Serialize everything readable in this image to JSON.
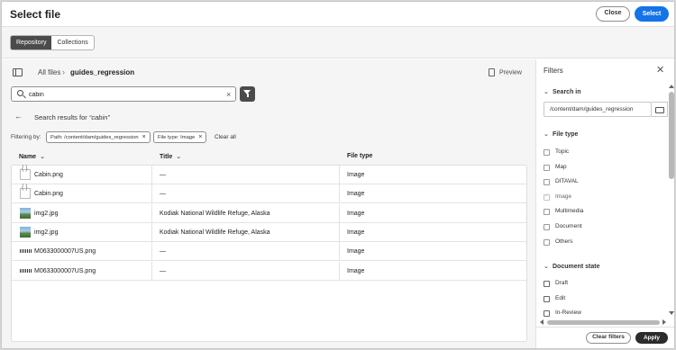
{
  "header": {
    "title": "Select file",
    "close_label": "Close",
    "select_label": "Select"
  },
  "tabs": [
    {
      "label": "Repository",
      "active": true
    },
    {
      "label": "Collections",
      "active": false
    }
  ],
  "breadcrumb": {
    "root": "All files",
    "current": "guides_regression"
  },
  "preview_label": "Preview",
  "search": {
    "value": "cabin",
    "placeholder": ""
  },
  "results": {
    "prefix": "Search results for",
    "query": "“cabin”"
  },
  "filtering": {
    "label": "Filtering by:",
    "chips": [
      "Path: /content/dam/guides_regression",
      "File type: Image"
    ],
    "clear_all": "Clear all"
  },
  "table": {
    "columns": [
      "Name",
      "Title",
      "File type"
    ],
    "rows": [
      {
        "thumb": "cabin",
        "name": "Cabin.png",
        "title": "—",
        "type": "Image"
      },
      {
        "thumb": "cabin",
        "name": "Cabin.png",
        "title": "—",
        "type": "Image"
      },
      {
        "thumb": "img2",
        "name": "img2.jpg",
        "title": "Kodiak National Wildlife Refuge, Alaska",
        "type": "Image"
      },
      {
        "thumb": "img2",
        "name": "img2.jpg",
        "title": "Kodiak National Wildlife Refuge, Alaska",
        "type": "Image"
      },
      {
        "thumb": "mcode",
        "name": "M0633000007US.png",
        "title": "—",
        "type": "Image"
      },
      {
        "thumb": "mcode",
        "name": "M0633000007US.png",
        "title": "—",
        "type": "Image"
      }
    ]
  },
  "filters": {
    "title": "Filters",
    "search_in": {
      "label": "Search in",
      "path": "/content/dam/guides_regression"
    },
    "file_type": {
      "label": "File type",
      "options": [
        {
          "label": "Topic",
          "checked": false,
          "disabled": false
        },
        {
          "label": "Map",
          "checked": false,
          "disabled": false
        },
        {
          "label": "DITAVAL",
          "checked": false,
          "disabled": false
        },
        {
          "label": "Image",
          "checked": true,
          "disabled": true
        },
        {
          "label": "Multimedia",
          "checked": false,
          "disabled": false
        },
        {
          "label": "Document",
          "checked": false,
          "disabled": false
        },
        {
          "label": "Others",
          "checked": false,
          "disabled": false
        }
      ]
    },
    "document_state": {
      "label": "Document state",
      "options": [
        {
          "label": "Draft"
        },
        {
          "label": "Edit"
        },
        {
          "label": "In-Review"
        }
      ]
    },
    "clear_label": "Clear filters",
    "apply_label": "Apply"
  },
  "colors": {
    "accent": "#1473e6",
    "dark_button": "#2c2c2c",
    "active_tab": "#4b4b4b"
  }
}
